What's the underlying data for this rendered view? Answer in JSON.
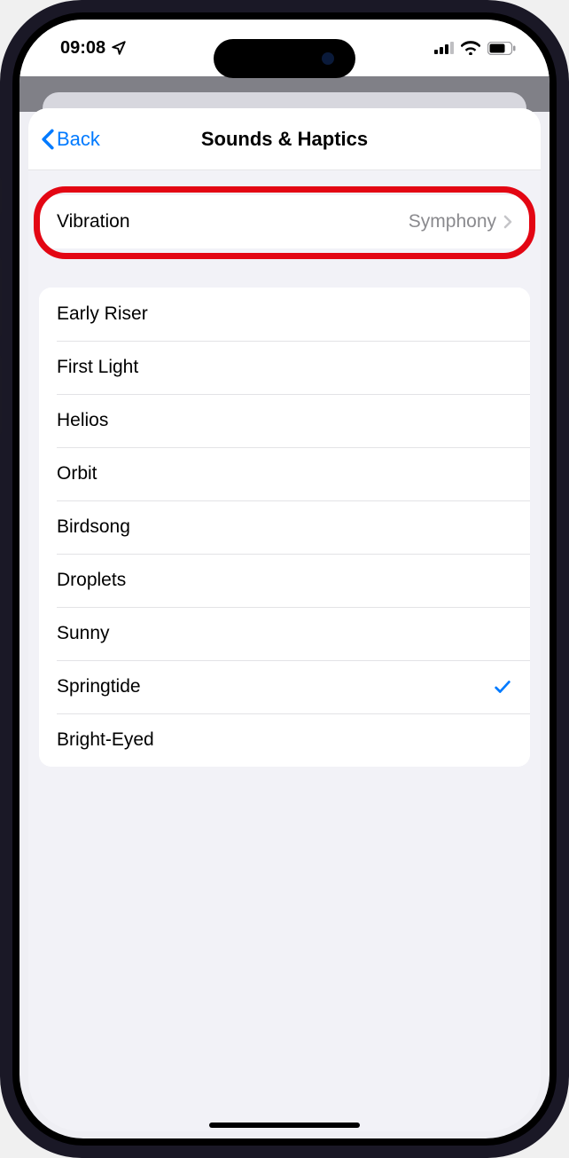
{
  "status": {
    "time": "09:08"
  },
  "nav": {
    "back": "Back",
    "title": "Sounds & Haptics"
  },
  "vibration": {
    "label": "Vibration",
    "value": "Symphony"
  },
  "sounds": [
    {
      "name": "Early Riser",
      "selected": false
    },
    {
      "name": "First Light",
      "selected": false
    },
    {
      "name": "Helios",
      "selected": false
    },
    {
      "name": "Orbit",
      "selected": false
    },
    {
      "name": "Birdsong",
      "selected": false
    },
    {
      "name": "Droplets",
      "selected": false
    },
    {
      "name": "Sunny",
      "selected": false
    },
    {
      "name": "Springtide",
      "selected": true
    },
    {
      "name": "Bright-Eyed",
      "selected": false
    }
  ],
  "colors": {
    "accent": "#007aff",
    "callout": "#e30613"
  }
}
